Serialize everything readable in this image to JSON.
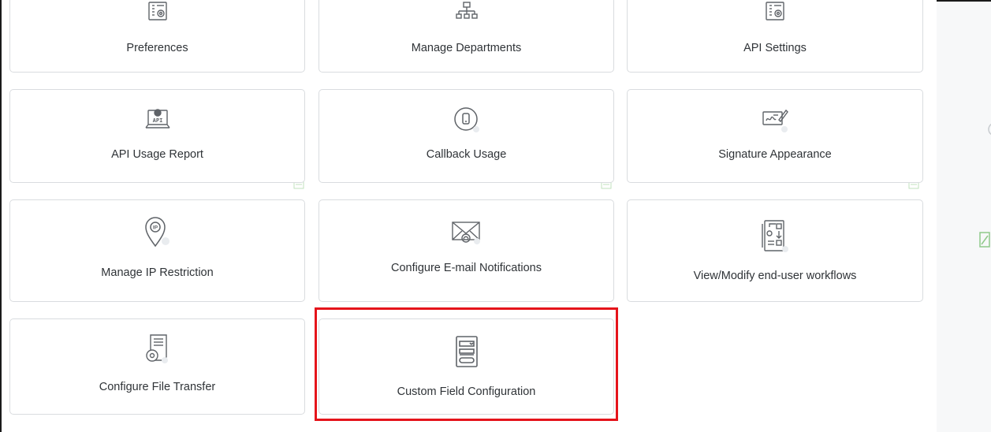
{
  "cards": [
    {
      "label": "Preferences",
      "icon": "settings-form-icon"
    },
    {
      "label": "Manage Departments",
      "icon": "org-chart-icon"
    },
    {
      "label": "API Settings",
      "icon": "settings-form-icon"
    },
    {
      "label": "API Usage Report",
      "icon": "api-laptop-icon"
    },
    {
      "label": "Callback Usage",
      "icon": "phone-circle-icon"
    },
    {
      "label": "Signature Appearance",
      "icon": "signature-pen-icon"
    },
    {
      "label": "Manage IP Restriction",
      "icon": "ip-location-pin-icon"
    },
    {
      "label": "Configure E-mail Notifications",
      "icon": "envelope-bell-icon"
    },
    {
      "label": "View/Modify end-user workflows",
      "icon": "workflow-document-icon"
    },
    {
      "label": "Configure File Transfer",
      "icon": "file-gear-icon"
    },
    {
      "label": "Custom Field Configuration",
      "icon": "form-fields-icon"
    }
  ],
  "selected_card": "Custom Field Configuration",
  "colors": {
    "border": "#d9dcdf",
    "icon_stroke": "#5f6368",
    "highlight": "#e5141b",
    "label": "#2f3337"
  }
}
